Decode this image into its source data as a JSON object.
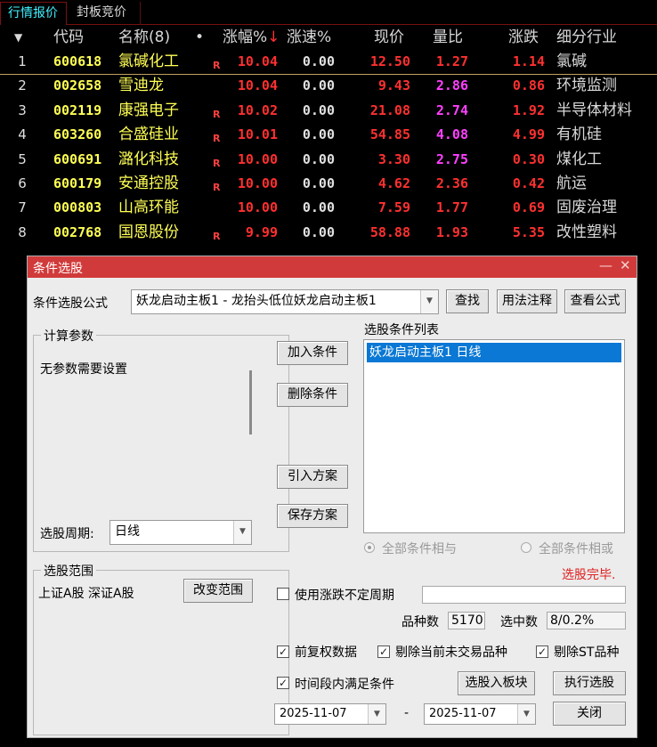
{
  "tabs": [
    {
      "label": "行情报价"
    },
    {
      "label": "封板竞价"
    }
  ],
  "table": {
    "headers": {
      "sort_arrow": "▼",
      "code": "代码",
      "name": "名称(8)",
      "dot": "•",
      "change_pct": "涨幅%",
      "change_sort": "↓",
      "speed": "涨速%",
      "price": "现价",
      "volume_ratio": "量比",
      "rise": "涨跌",
      "industry": "细分行业"
    },
    "rows": [
      {
        "idx": "1",
        "code": "600618",
        "name": "氯碱化工",
        "flag": "R",
        "change_pct": "10.04",
        "speed": "0.00",
        "price": "12.50",
        "volume_ratio": "1.27",
        "vr_color": "red",
        "rise": "1.14",
        "industry": "氯碱"
      },
      {
        "idx": "2",
        "code": "002658",
        "name": "雪迪龙",
        "flag": "",
        "change_pct": "10.04",
        "speed": "0.00",
        "price": "9.43",
        "volume_ratio": "2.86",
        "vr_color": "purple",
        "rise": "0.86",
        "industry": "环境监测"
      },
      {
        "idx": "3",
        "code": "002119",
        "name": "康强电子",
        "flag": "R",
        "change_pct": "10.02",
        "speed": "0.00",
        "price": "21.08",
        "volume_ratio": "2.74",
        "vr_color": "purple",
        "rise": "1.92",
        "industry": "半导体材料"
      },
      {
        "idx": "4",
        "code": "603260",
        "name": "合盛硅业",
        "flag": "R",
        "change_pct": "10.01",
        "speed": "0.00",
        "price": "54.85",
        "volume_ratio": "4.08",
        "vr_color": "purple",
        "rise": "4.99",
        "industry": "有机硅"
      },
      {
        "idx": "5",
        "code": "600691",
        "name": "潞化科技",
        "flag": "R",
        "change_pct": "10.00",
        "speed": "0.00",
        "price": "3.30",
        "volume_ratio": "2.75",
        "vr_color": "purple",
        "rise": "0.30",
        "industry": "煤化工"
      },
      {
        "idx": "6",
        "code": "600179",
        "name": "安通控股",
        "flag": "R",
        "change_pct": "10.00",
        "speed": "0.00",
        "price": "4.62",
        "volume_ratio": "2.36",
        "vr_color": "red",
        "rise": "0.42",
        "industry": "航运"
      },
      {
        "idx": "7",
        "code": "000803",
        "name": "山高环能",
        "flag": "",
        "change_pct": "10.00",
        "speed": "0.00",
        "price": "7.59",
        "volume_ratio": "1.77",
        "vr_color": "red",
        "rise": "0.69",
        "industry": "固废治理"
      },
      {
        "idx": "8",
        "code": "002768",
        "name": "国恩股份",
        "flag": "R",
        "change_pct": "9.99",
        "speed": "0.00",
        "price": "58.88",
        "volume_ratio": "1.93",
        "vr_color": "red",
        "rise": "5.35",
        "industry": "改性塑料"
      }
    ]
  },
  "dialog": {
    "title": "条件选股",
    "minimize_glyph": "—",
    "close_glyph": "✕",
    "formula_label": "条件选股公式",
    "formula_value": "妖龙启动主板1  -  龙抬头低位妖龙启动主板1",
    "find_button": "查找",
    "usage_button": "用法注释",
    "view_formula_button": "查看公式",
    "params_group": "计算参数",
    "params_text": "无参数需要设置",
    "period_label": "选股周期:",
    "period_value": "日线",
    "add_condition_button": "加入条件",
    "delete_condition_button": "删除条件",
    "import_plan_button": "引入方案",
    "save_plan_button": "保存方案",
    "condition_list_label": "选股条件列表",
    "condition_items": [
      "妖龙启动主板1  日线"
    ],
    "radio_and": "全部条件相与",
    "radio_or": "全部条件相或",
    "status_text": "选股完毕.",
    "scope_group": "选股范围",
    "scope_text": "上证A股 深证A股",
    "change_scope_button": "改变范围",
    "use_irregular_period": "使用涨跌不定周期",
    "count_label": "品种数",
    "count_value": "5170",
    "selected_label": "选中数",
    "selected_value": "8/0.2%",
    "forward_adjust": "前复权数据",
    "exclude_untraded": "剔除当前未交易品种",
    "exclude_st": "剔除ST品种",
    "time_range_condition": "时间段内满足条件",
    "to_block_button": "选股入板块",
    "execute_button": "执行选股",
    "date_from": "2025-11-07",
    "date_sep": "-",
    "date_to": "2025-11-07",
    "close_button": "关闭",
    "checkmark": "✓",
    "dropdown_glyph": "▼",
    "colors": {
      "titlebar": "#d13a3a",
      "selection": "#0a78d4",
      "status": "#e02020"
    }
  }
}
